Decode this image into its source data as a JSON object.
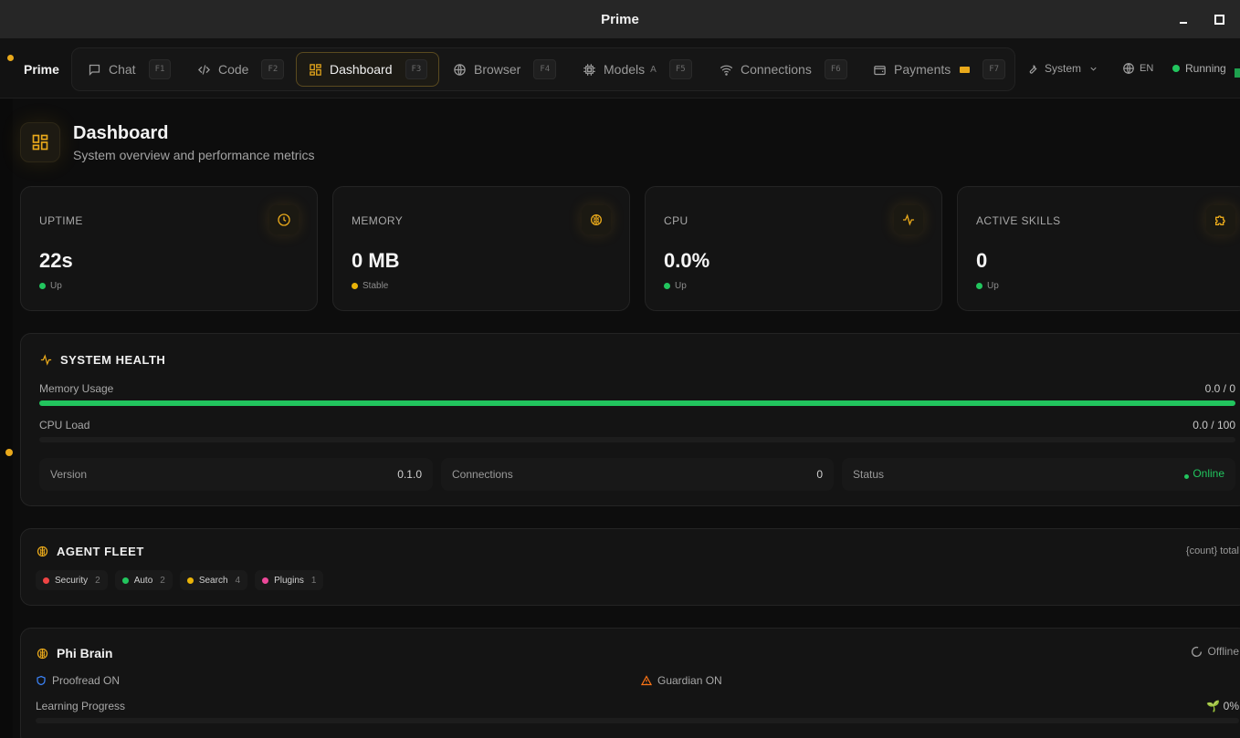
{
  "window": {
    "title": "Prime"
  },
  "nav": {
    "brand": "Prime",
    "tabs": [
      {
        "label": "Chat",
        "key": "F1",
        "icon": "chat-icon"
      },
      {
        "label": "Code",
        "key": "F2",
        "icon": "code-icon"
      },
      {
        "label": "Dashboard",
        "key": "F3",
        "icon": "dashboard-icon",
        "active": true
      },
      {
        "label": "Browser",
        "key": "F4",
        "icon": "globe-icon"
      },
      {
        "label": "Models",
        "badge": "A",
        "key": "F5",
        "icon": "chip-icon"
      },
      {
        "label": "Connections",
        "key": "F6",
        "icon": "wifi-icon"
      },
      {
        "label": "Payments",
        "key": "F7",
        "icon": "wallet-icon"
      }
    ],
    "system_label": "System",
    "language": "EN",
    "status": "Running"
  },
  "page": {
    "title": "Dashboard",
    "subtitle": "System overview and performance metrics"
  },
  "stats": [
    {
      "label": "UPTIME",
      "value": "22s",
      "trend": "Up",
      "trend_color": "#22c55e",
      "icon": "clock-icon"
    },
    {
      "label": "MEMORY",
      "value": "0 MB",
      "trend": "Stable",
      "trend_color": "#eab308",
      "icon": "brain-icon"
    },
    {
      "label": "CPU",
      "value": "0.0%",
      "trend": "Up",
      "trend_color": "#22c55e",
      "icon": "activity-icon"
    },
    {
      "label": "ACTIVE SKILLS",
      "value": "0",
      "trend": "Up",
      "trend_color": "#22c55e",
      "icon": "puzzle-icon"
    }
  ],
  "health": {
    "title": "SYSTEM HEALTH",
    "memory_label": "Memory Usage",
    "memory_value": "0.0 / 0",
    "memory_fill": 1.0,
    "cpu_label": "CPU Load",
    "cpu_value": "0.0 / 100",
    "cpu_fill": 0.0,
    "version_label": "Version",
    "version_value": "0.1.0",
    "connections_label": "Connections",
    "connections_value": "0",
    "status_label": "Status",
    "status_value": "Online"
  },
  "fleet": {
    "title": "AGENT FLEET",
    "count_text": "{count} total",
    "chips": [
      {
        "label": "Security",
        "count": "2",
        "color": "#ef4444"
      },
      {
        "label": "Auto",
        "count": "2",
        "color": "#22c55e"
      },
      {
        "label": "Search",
        "count": "4",
        "color": "#eab308"
      },
      {
        "label": "Plugins",
        "count": "1",
        "color": "#ec4899"
      }
    ]
  },
  "phi": {
    "title": "Phi Brain",
    "status": "Offline",
    "proofread": "Proofread ON",
    "guardian": "Guardian ON",
    "learning_label": "Learning Progress",
    "learning_value": "🌱 0%",
    "learning_fill": 0.0
  },
  "colors": {
    "accent": "#e9a91b",
    "green": "#22c55e"
  }
}
